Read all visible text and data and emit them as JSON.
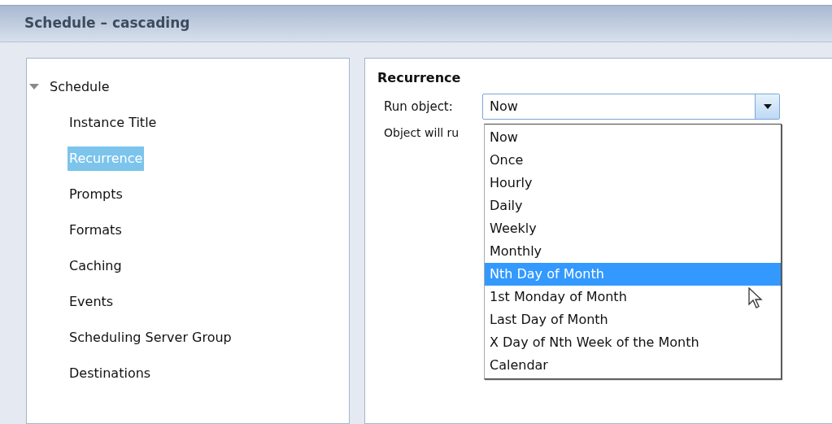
{
  "window": {
    "title": "Schedule – cascading"
  },
  "tree": {
    "label": "Schedule",
    "expanded": true,
    "children": [
      {
        "label": "Instance Title",
        "selected": false
      },
      {
        "label": "Recurrence",
        "selected": true
      },
      {
        "label": "Prompts",
        "selected": false
      },
      {
        "label": "Formats",
        "selected": false
      },
      {
        "label": "Caching",
        "selected": false
      },
      {
        "label": "Events",
        "selected": false
      },
      {
        "label": "Scheduling Server Group",
        "selected": false
      },
      {
        "label": "Destinations",
        "selected": false
      }
    ]
  },
  "section": {
    "title": "Recurrence",
    "run_label": "Run object:",
    "run_value": "Now",
    "info_text": "Object will ru",
    "dropdown": {
      "expanded": true,
      "options": [
        {
          "label": "Now",
          "selected": false
        },
        {
          "label": "Once",
          "selected": false
        },
        {
          "label": "Hourly",
          "selected": false
        },
        {
          "label": "Daily",
          "selected": false
        },
        {
          "label": "Weekly",
          "selected": false
        },
        {
          "label": "Monthly",
          "selected": false
        },
        {
          "label": "Nth Day of Month",
          "selected": true
        },
        {
          "label": "1st Monday of Month",
          "selected": false
        },
        {
          "label": "Last Day of Month",
          "selected": false
        },
        {
          "label": "X Day of Nth Week of the Month",
          "selected": false
        },
        {
          "label": "Calendar",
          "selected": false
        }
      ]
    }
  }
}
